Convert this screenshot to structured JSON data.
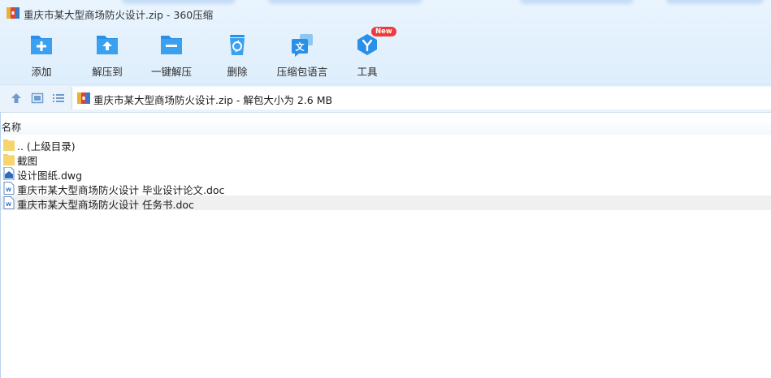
{
  "window": {
    "title": "重庆市某大型商场防火设计.zip - 360压缩"
  },
  "toolbar": {
    "items": [
      {
        "label": "添加",
        "icon": "add-icon"
      },
      {
        "label": "解压到",
        "icon": "extract-to-icon"
      },
      {
        "label": "一键解压",
        "icon": "one-click-extract-icon"
      },
      {
        "label": "删除",
        "icon": "delete-icon"
      },
      {
        "label": "压缩包语言",
        "icon": "language-icon"
      },
      {
        "label": "工具",
        "icon": "tools-icon",
        "badge": "New"
      }
    ]
  },
  "nav": {
    "path": "重庆市某大型商场防火设计.zip - 解包大小为 2.6 MB"
  },
  "file_list": {
    "column_name": "名称",
    "rows": [
      {
        "name": ".. (上级目录)",
        "type": "folder",
        "selected": false
      },
      {
        "name": "截图",
        "type": "folder",
        "selected": false
      },
      {
        "name": "设计图纸.dwg",
        "type": "dwg",
        "selected": false
      },
      {
        "name": "重庆市某大型商场防火设计 毕业设计论文.doc",
        "type": "doc",
        "selected": false
      },
      {
        "name": "重庆市某大型商场防火设计 任务书.doc",
        "type": "doc",
        "selected": true
      }
    ]
  },
  "colors": {
    "accent": "#2a93e8",
    "badge": "#ee3b3b",
    "folder": "#f5cf62"
  }
}
